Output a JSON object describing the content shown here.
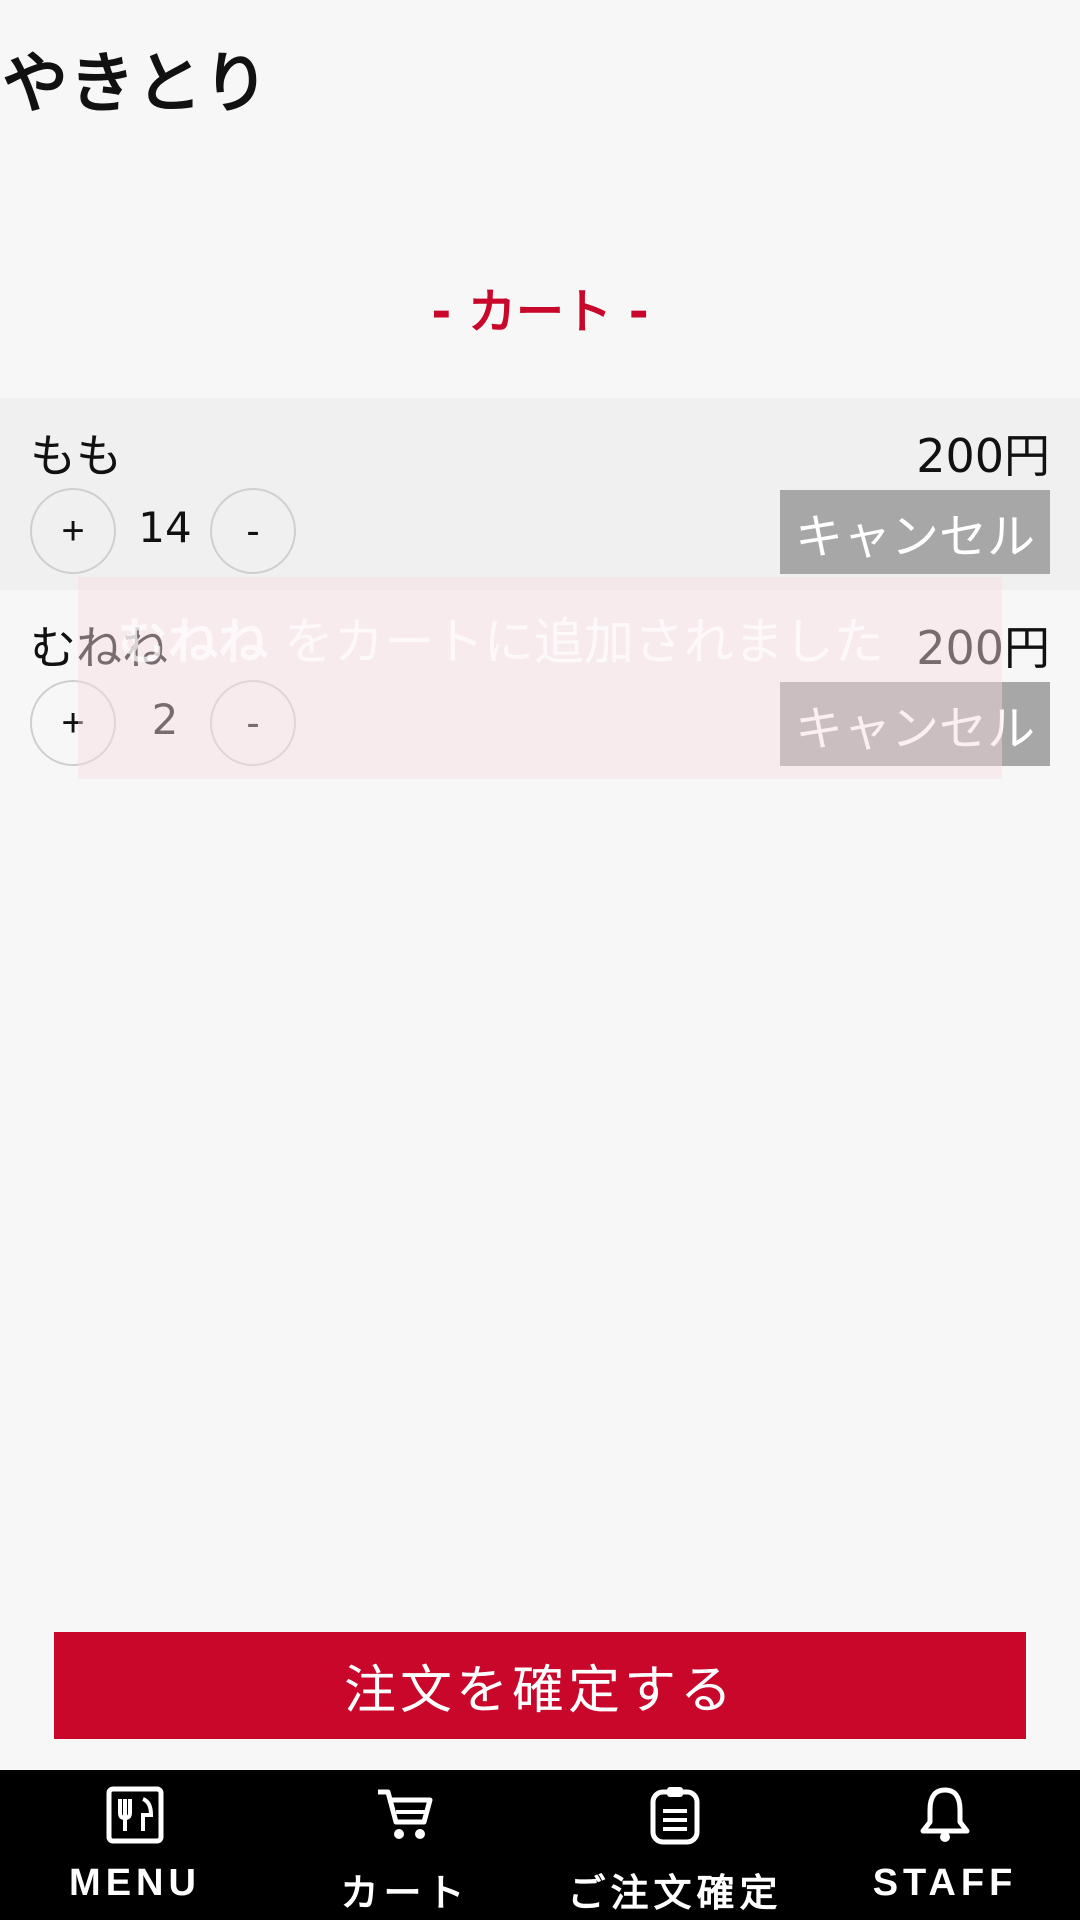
{
  "app": {
    "title": "やきとり"
  },
  "cart": {
    "heading": "- カート -",
    "items": [
      {
        "name": "もも",
        "price": "200円",
        "quantity": "14",
        "plus": "+",
        "minus": "-",
        "cancel": "キャンセル"
      },
      {
        "name": "むねね",
        "price": "200円",
        "quantity": "2",
        "plus": "+",
        "minus": "-",
        "cancel": "キャンセル"
      }
    ]
  },
  "toast": {
    "item": "むねね",
    "message": " をカートに追加されました"
  },
  "confirm": {
    "label": "注文を確定する"
  },
  "nav": {
    "items": [
      {
        "label": "MENU",
        "icon": "menu-icon"
      },
      {
        "label": "カート",
        "icon": "cart-icon"
      },
      {
        "label": "ご注文確定",
        "icon": "order-confirm-icon"
      },
      {
        "label": "STAFF",
        "icon": "bell-icon"
      }
    ]
  },
  "colors": {
    "accent": "#c8072a",
    "cancel": "#a7a7a7",
    "nav_bg": "#000000"
  }
}
